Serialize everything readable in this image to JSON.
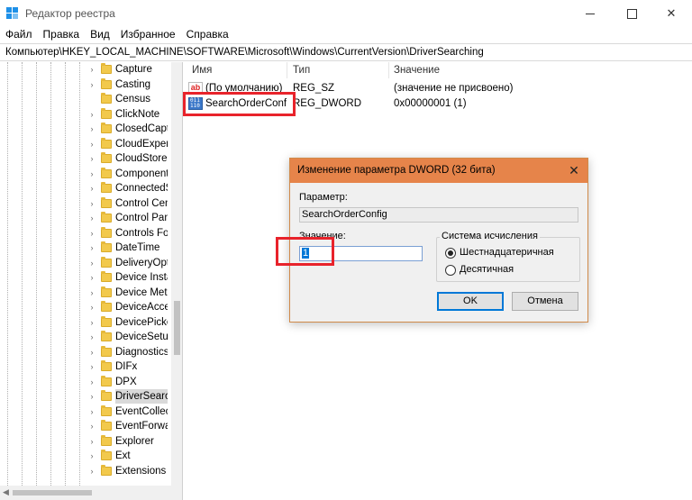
{
  "window": {
    "title": "Редактор реестра"
  },
  "menu": [
    "Файл",
    "Правка",
    "Вид",
    "Избранное",
    "Справка"
  ],
  "address": "Компьютер\\HKEY_LOCAL_MACHINE\\SOFTWARE\\Microsoft\\Windows\\CurrentVersion\\DriverSearching",
  "tree": {
    "items": [
      {
        "label": "Capture",
        "expandable": true
      },
      {
        "label": "Casting",
        "expandable": true
      },
      {
        "label": "Census",
        "expandable": false
      },
      {
        "label": "ClickNote",
        "expandable": true
      },
      {
        "label": "ClosedCapt",
        "expandable": true
      },
      {
        "label": "CloudExper",
        "expandable": true
      },
      {
        "label": "CloudStore",
        "expandable": true
      },
      {
        "label": "Component",
        "expandable": true
      },
      {
        "label": "ConnectedS",
        "expandable": true
      },
      {
        "label": "Control Cen",
        "expandable": true
      },
      {
        "label": "Control Pan",
        "expandable": true
      },
      {
        "label": "Controls Fol",
        "expandable": true
      },
      {
        "label": "DateTime",
        "expandable": true
      },
      {
        "label": "DeliveryOpt",
        "expandable": true
      },
      {
        "label": "Device Insta",
        "expandable": true
      },
      {
        "label": "Device Meta",
        "expandable": true
      },
      {
        "label": "DeviceAcce",
        "expandable": true
      },
      {
        "label": "DevicePicke",
        "expandable": true
      },
      {
        "label": "DeviceSetup",
        "expandable": true
      },
      {
        "label": "Diagnostics",
        "expandable": true
      },
      {
        "label": "DIFx",
        "expandable": true
      },
      {
        "label": "DPX",
        "expandable": true
      },
      {
        "label": "DriverSearc",
        "expandable": true,
        "selected": true
      },
      {
        "label": "EventCollec",
        "expandable": true
      },
      {
        "label": "EventForwa",
        "expandable": true
      },
      {
        "label": "Explorer",
        "expandable": true
      },
      {
        "label": "Ext",
        "expandable": true
      },
      {
        "label": "Extensions",
        "expandable": true
      }
    ]
  },
  "values_table": {
    "columns": [
      "Имя",
      "Тип",
      "Значение"
    ],
    "rows": [
      {
        "icon": "string-value-icon",
        "name": "(По умолчанию)",
        "type": "REG_SZ",
        "data": "(значение не присвоено)"
      },
      {
        "icon": "binary-value-icon",
        "name": "SearchOrderConf",
        "type": "REG_DWORD",
        "data": "0x00000001 (1)"
      }
    ]
  },
  "dialog": {
    "title": "Изменение параметра DWORD (32 бита)",
    "param_label": "Параметр:",
    "param_value": "SearchOrderConfig",
    "value_label": "Значение:",
    "value": "1",
    "base_group_label": "Система исчисления",
    "base_options": [
      {
        "label": "Шестнадцатеричная",
        "selected": true
      },
      {
        "label": "Десятичная",
        "selected": false
      }
    ],
    "ok_label": "OK",
    "cancel_label": "Отмена"
  },
  "colors": {
    "dialog_title_bg": "#e6844a",
    "highlight_box": "#e8232b",
    "selection": "#0078d7"
  }
}
